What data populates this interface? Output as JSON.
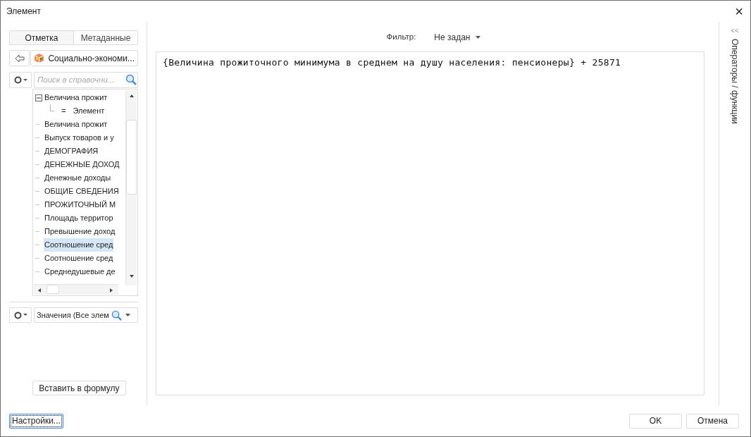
{
  "window": {
    "title": "Элемент",
    "close": "×"
  },
  "left_tabs": [
    {
      "label": "Отметка",
      "selected": true
    },
    {
      "label": "Метаданные",
      "selected": false
    }
  ],
  "source": {
    "label": "Социально-экономи..."
  },
  "search": {
    "placeholder": "Поиск в справочни..."
  },
  "tree": [
    {
      "label": "Величина прожит",
      "expanded": true,
      "selected": false,
      "children": [
        {
          "label": "Элемент",
          "prefix": "="
        }
      ]
    },
    {
      "label": "Величина прожит",
      "selected": false
    },
    {
      "label": "Выпуск товаров и у",
      "selected": false
    },
    {
      "label": "ДЕМОГРАФИЯ",
      "selected": false
    },
    {
      "label": "ДЕНЕЖНЫЕ ДОХОД",
      "selected": false
    },
    {
      "label": "Денежные доходы",
      "selected": false
    },
    {
      "label": "ОБЩИЕ СВЕДЕНИЯ",
      "selected": false
    },
    {
      "label": "ПРОЖИТОЧНЫЙ М",
      "selected": false
    },
    {
      "label": "Площадь территор",
      "selected": false
    },
    {
      "label": "Превышение доход",
      "selected": false
    },
    {
      "label": "Соотношение сред",
      "selected": true
    },
    {
      "label": "Соотношение сред",
      "selected": false
    },
    {
      "label": "Среднедушевые де",
      "selected": false
    }
  ],
  "values_combo": {
    "value": "Значения (Все элем"
  },
  "insert_button": "Вставить в формулу",
  "filter": {
    "label": "Фильтр:",
    "value": "Не задан"
  },
  "formula": "{Величина прожиточного минимума в среднем на душу населения: пенсионеры} + 25871",
  "side_panel": {
    "collapse": "<<",
    "title": "Операторы / функции"
  },
  "settings_button": "Настройки...",
  "buttons": [
    "OK",
    "Отмена"
  ]
}
